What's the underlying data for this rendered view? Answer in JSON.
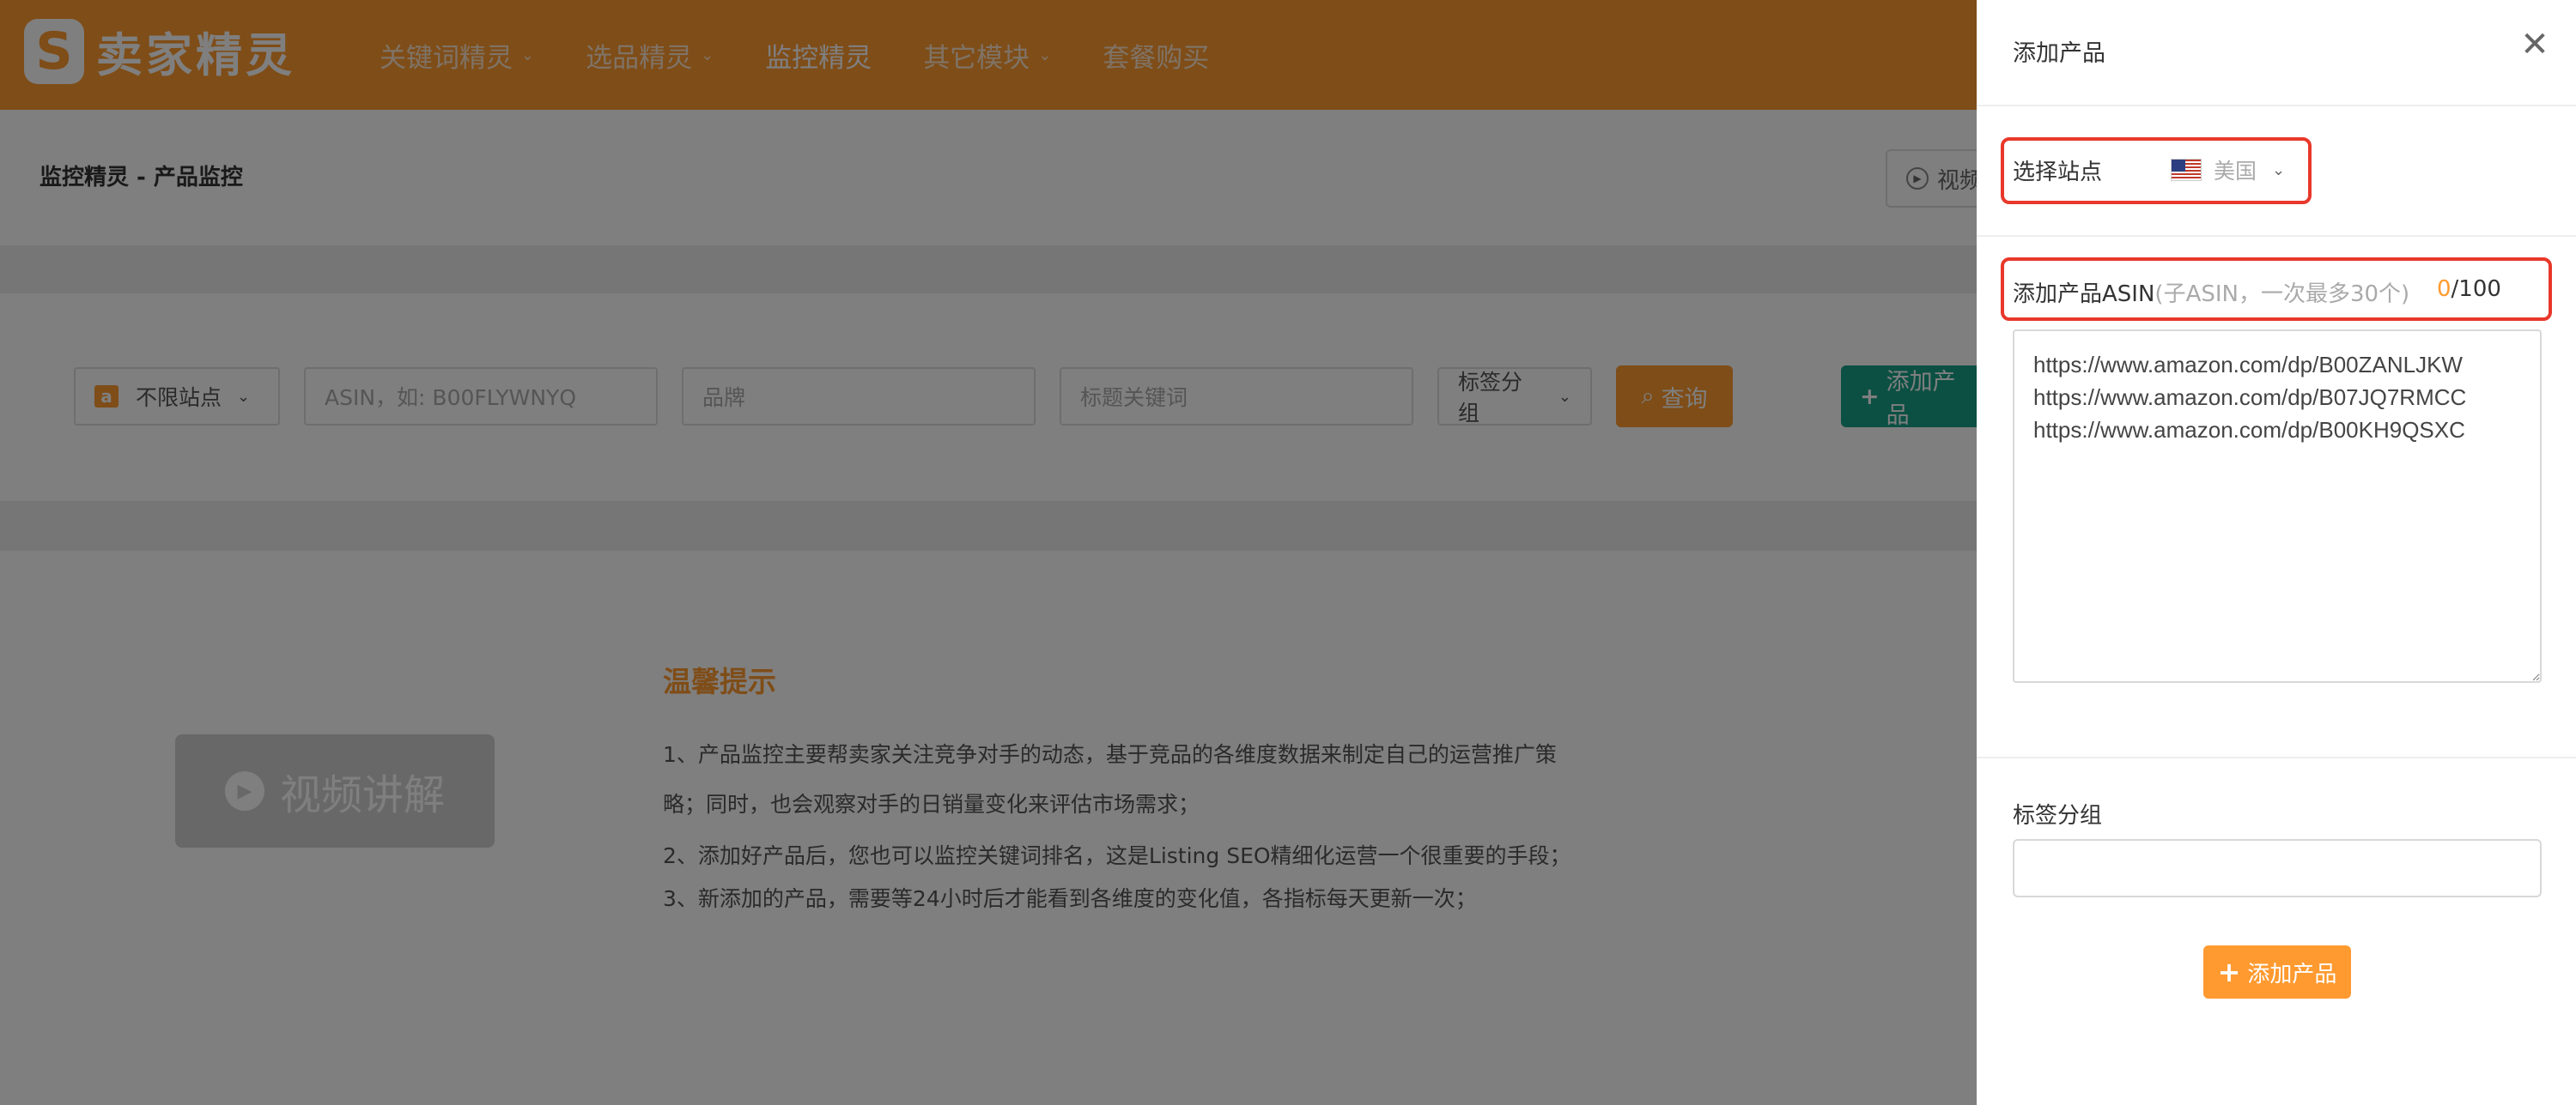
{
  "header": {
    "logo_text": "卖家精灵",
    "nav": [
      {
        "label": "关键词精灵",
        "has_dropdown": true
      },
      {
        "label": "选品精灵",
        "has_dropdown": true
      },
      {
        "label": "监控精灵",
        "has_dropdown": false
      },
      {
        "label": "其它模块",
        "has_dropdown": true
      },
      {
        "label": "套餐购买",
        "has_dropdown": false
      }
    ]
  },
  "page": {
    "title": "监控精灵 - 产品监控",
    "video_button": "视频"
  },
  "filters": {
    "site_select": "不限站点",
    "asin_placeholder": "ASIN，如: B00FLYWNYQ",
    "brand_placeholder": "品牌",
    "title_keyword_placeholder": "标题关键词",
    "tag_group": "标签分组",
    "query_button": "查询",
    "add_product_button": "添加产品"
  },
  "tips": {
    "video_button": "视频讲解",
    "title": "温馨提示",
    "lines": [
      "1、产品监控主要帮卖家关注竞争对手的动态，基于竞品的各维度数据来制定自己的运营推广策",
      "略；同时，也会观察对手的日销量变化来评估市场需求；",
      "2、添加好产品后，您也可以监控关键词排名，这是Listing SEO精细化运营一个很重要的手段；",
      "3、新添加的产品，需要等24小时后才能看到各维度的变化值，各指标每天更新一次；"
    ]
  },
  "drawer": {
    "title": "添加产品",
    "site_label": "选择站点",
    "site_value": "美国",
    "asin_label": "添加产品ASIN",
    "asin_hint": "(子ASIN，一次最多30个)",
    "counter_current": "0",
    "counter_max": "/100",
    "asin_text": "https://www.amazon.com/dp/B00ZANLJKW\nhttps://www.amazon.com/dp/B07JQ7RMCC\nhttps://www.amazon.com/dp/B00KH9QSXC",
    "tag_label": "标签分组",
    "tag_value": "",
    "submit_button": "添加产品"
  },
  "colors": {
    "brand_orange": "#ff9a30",
    "add_green": "#16a086",
    "highlight_red": "#e8382b"
  }
}
